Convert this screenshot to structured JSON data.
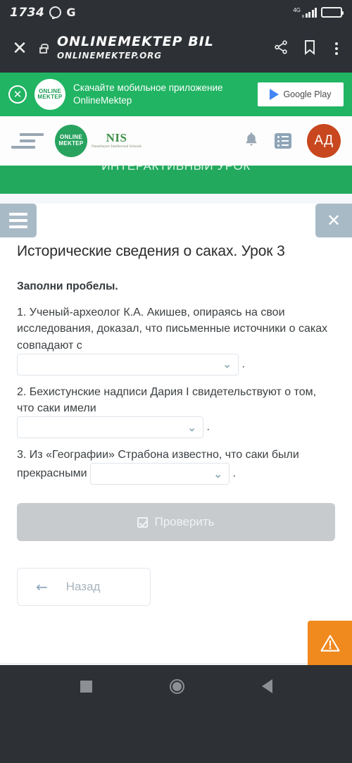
{
  "status_bar": {
    "time": "1734",
    "whatsapp_icon": "whatsapp-icon",
    "carrier_letter": "G",
    "network_type": "4G",
    "battery_icon": "battery-icon"
  },
  "browser_bar": {
    "close_icon": "close-icon",
    "lock_icon": "lock-icon",
    "page_title": "ONLINEMEKTEP BIL",
    "page_url": "ONLINEMEKTEP.ORG",
    "share_icon": "share-icon",
    "bookmark_icon": "bookmark-icon",
    "overflow_icon": "more-vertical-icon"
  },
  "app_banner": {
    "close_icon": "close-circle-icon",
    "logo_line1": "ONLINE",
    "logo_line2": "MEKTEP",
    "message": "Скачайте мобильное приложение OnlineMektep",
    "store_button": "Google Play",
    "background_color": "#21b463"
  },
  "site_header": {
    "menu_icon": "indent-menu-icon",
    "logo_online": "ONLINE",
    "logo_mektep": "MEKTEP",
    "nis_title": "NIS",
    "nis_subtitle": "Nazarbayev Intellectual Schools",
    "bell_icon": "bell-icon",
    "list_icon": "list-icon",
    "avatar_initials": "АД",
    "avatar_color": "#c8471e"
  },
  "lesson_bar": {
    "label": "ИНТЕРАКТИВНЫЙ УРОК",
    "background_color": "#22a95e"
  },
  "content": {
    "menu_button_icon": "hamburger-icon",
    "close_button_icon": "close-icon",
    "title": "Исторические сведения о саках. Урок 3",
    "task_label": "Заполни пробелы.",
    "questions": [
      {
        "text": "1. Ученый-археолог К.А. Акишев, опираясь на свои исследования, доказал, что письменные источники о саках совпадают с",
        "select_value": "",
        "chevron": "chevron-down-icon",
        "trailing": "."
      },
      {
        "text": "2. Бехистунские надписи Дария I свидетельствуют о том, что саки имели",
        "select_value": "",
        "chevron": "chevron-down-icon",
        "trailing": "."
      },
      {
        "text_before": "3. Из «Географии» Страбона известно, что саки были прекрасными",
        "select_value": "",
        "chevron": "chevron-down-icon",
        "trailing": "."
      }
    ],
    "check_button": {
      "label": "Проверить",
      "icon": "checkbox-checked-icon",
      "disabled": true,
      "color": "#c8cbcd"
    },
    "back_button": {
      "label": "Назад",
      "icon": "arrow-left-icon"
    },
    "warn_fab": {
      "icon": "warning-triangle-icon",
      "color": "#f0891e"
    }
  },
  "nav_bar": {
    "recents_icon": "square-icon",
    "home_icon": "circle-icon",
    "back_icon": "triangle-back-icon"
  }
}
